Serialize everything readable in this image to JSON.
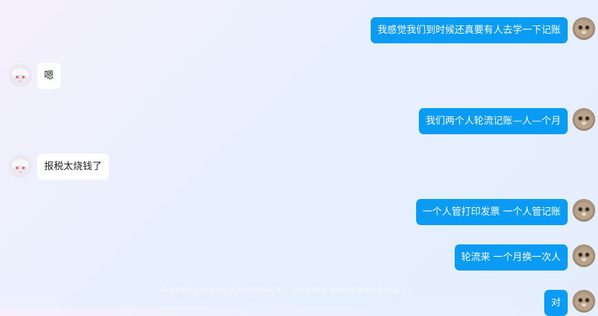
{
  "messages": [
    {
      "side": "right",
      "text": "我感觉我们到时候还真要有人去学一下记账",
      "avatar": "cat-avatar-icon"
    },
    {
      "side": "left",
      "text": "嗯",
      "avatar": "anime-girl-avatar-icon"
    },
    {
      "side": "right",
      "text": "我们两个人轮流记账—人—个月",
      "avatar": "cat-avatar-icon"
    },
    {
      "side": "left",
      "text": "报税太烧钱了",
      "avatar": "anime-girl-avatar-icon"
    },
    {
      "side": "right",
      "text": "一个人管打印发票 一个人管记账",
      "avatar": "cat-avatar-icon"
    },
    {
      "side": "right",
      "text": "轮流来 一个月换一次人",
      "avatar": "cat-avatar-icon"
    },
    {
      "side": "right",
      "text": "对",
      "avatar": "cat-avatar-icon"
    }
  ],
  "watermark": "Serenity Wang's Notebook · serenity.wang/notebook.cc",
  "colors": {
    "outgoing_bubble": "#0a9bf5",
    "incoming_bubble": "#ffffff"
  }
}
